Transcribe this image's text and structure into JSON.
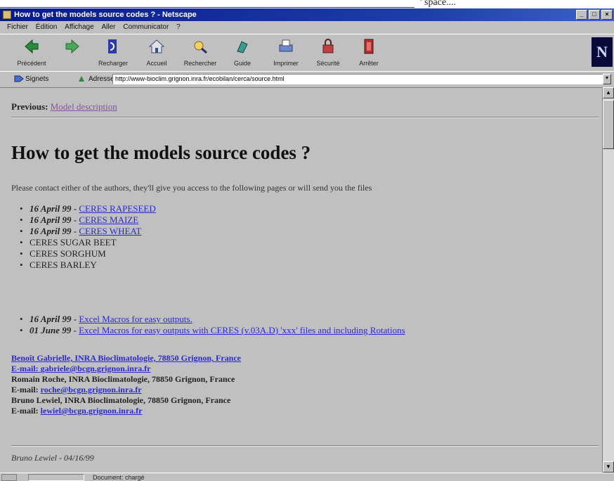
{
  "outer": {
    "right_text": "' space...."
  },
  "window": {
    "title": "How to get the models source codes ? - Netscape",
    "buttons": [
      "_",
      "□",
      "×"
    ]
  },
  "menu": [
    "Fichier",
    "Édition",
    "Affichage",
    "Aller",
    "Communicator",
    "?"
  ],
  "toolbar": {
    "items": [
      {
        "label": "Précédent",
        "icon": "back-arrow-icon"
      },
      {
        "label": "",
        "icon": "forward-arrow-icon"
      },
      {
        "label": "Recharger",
        "icon": "reload-icon"
      },
      {
        "label": "Accueil",
        "icon": "home-icon"
      },
      {
        "label": "Rechercher",
        "icon": "search-icon"
      },
      {
        "label": "Guide",
        "icon": "guide-icon"
      },
      {
        "label": "Imprimer",
        "icon": "print-icon"
      },
      {
        "label": "Sécurité",
        "icon": "lock-icon"
      },
      {
        "label": "Arrêter",
        "icon": "stop-icon"
      }
    ],
    "logo": "N"
  },
  "location": {
    "signets_label": "Signets",
    "address_label": "Adresse",
    "url": "http://www-bioclim.grignon.inra.fr/ecobilan/cerca/source.html"
  },
  "page": {
    "previous_label": "Previous:",
    "previous_link": "Model description",
    "heading": "How to get the models source codes ?",
    "intro": "Please contact either of the authors, they'll give you access to the following pages or will send you the files",
    "models": [
      {
        "date": "16 April 99",
        "sep": " - ",
        "name": "CERES RAPESEED",
        "link": true
      },
      {
        "date": "16 April 99",
        "sep": " - ",
        "name": "CERES MAIZE",
        "link": true
      },
      {
        "date": "16 April 99",
        "sep": " - ",
        "name": "CERES WHEAT",
        "link": true
      },
      {
        "date": "",
        "sep": "",
        "name": "CERES SUGAR BEET",
        "link": false
      },
      {
        "date": "",
        "sep": "",
        "name": "CERES SORGHUM",
        "link": false
      },
      {
        "date": "",
        "sep": "",
        "name": "CERES BARLEY",
        "link": false
      }
    ],
    "macros": [
      {
        "date": "16 April 99",
        "sep": " - ",
        "name": "Excel Macros for easy outputs."
      },
      {
        "date": "01 June 99",
        "sep": " - ",
        "name": "Excel Macros for easy outputs with CERES (v.03A.D) 'xxx' files and including Rotations"
      }
    ],
    "authors": [
      {
        "text": "Benoît Gabrielle, INRA Bioclimatologie, 78850 Grignon, France",
        "link": true
      },
      {
        "label": "E-mail: ",
        "email": "gabriele@bcgn.grignon.inra.fr",
        "all_link": true
      },
      {
        "text": "Romain Roche, INRA Bioclimatologie, 78850 Grignon, France",
        "link": false
      },
      {
        "label": "E-mail: ",
        "email": "roche@bcgn.grignon.inra.fr",
        "all_link": false
      },
      {
        "text": "Bruno Lewiel, INRA Bioclimatologie, 78850 Grignon, France",
        "link": false
      },
      {
        "label": "E-mail: ",
        "email": "lewiel@bcgn.grignon.inra.fr",
        "all_link": false
      }
    ],
    "footer": "Bruno Lewiel - 04/16/99"
  },
  "status": {
    "text": "Document: chargé"
  }
}
